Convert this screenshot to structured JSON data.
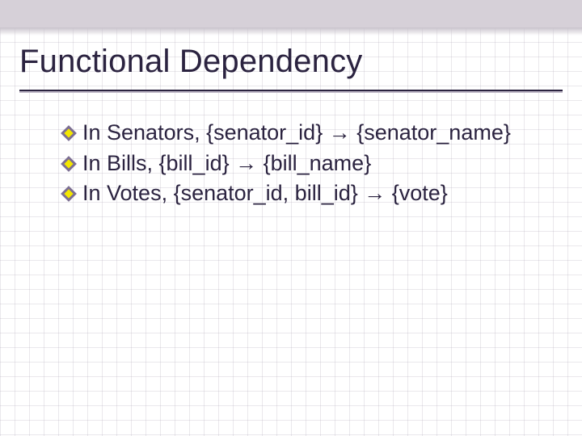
{
  "title": "Functional Dependency",
  "bullets": [
    {
      "text": "In Senators, {senator_id} → {senator_name}"
    },
    {
      "text": "In Bills, {bill_id} → {bill_name}"
    },
    {
      "text": "In Votes, {senator_id, bill_id} → {vote}"
    }
  ]
}
